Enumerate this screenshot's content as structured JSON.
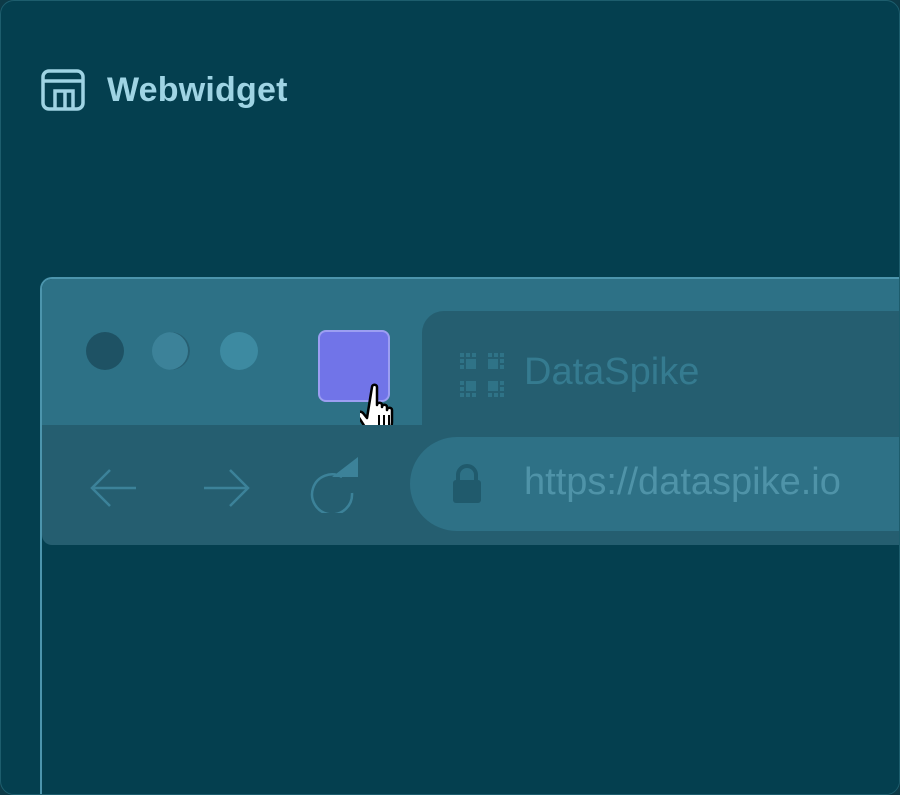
{
  "app": {
    "title": "Webwidget",
    "logo_icon": "browser-window-icon"
  },
  "browser": {
    "window_controls": [
      "close-dot",
      "minimize-dot",
      "maximize-dot"
    ],
    "widget_button": {
      "icon": "pip-widget-square",
      "color": "#7174e8"
    },
    "tab": {
      "title": "DataSpike",
      "icon": "dataspike-logo"
    },
    "nav": {
      "back_icon": "arrow-left-icon",
      "forward_icon": "arrow-right-icon",
      "reload_icon": "reload-icon"
    },
    "address": {
      "url": "https://dataspike.io",
      "lock_icon": "lock-icon"
    }
  },
  "colors": {
    "background": "#043f4f",
    "titlebar": "#2d7186",
    "toolbar": "#255e70",
    "accent": "#7174e8",
    "brand_text": "#9fd4e4"
  }
}
